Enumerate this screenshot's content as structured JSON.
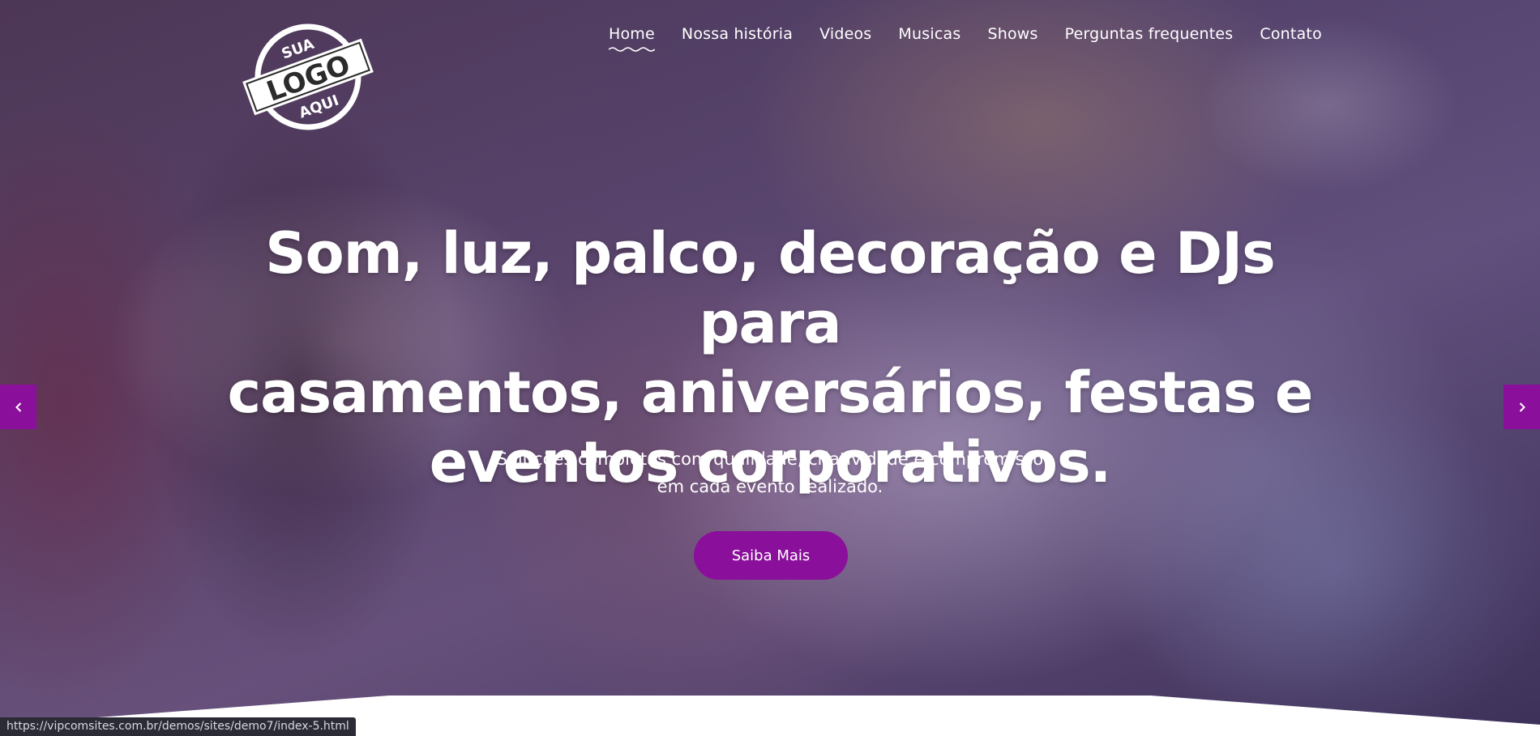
{
  "logo": {
    "top_text": "SUA",
    "main_text": "LOGO",
    "bottom_text": "AQUI"
  },
  "nav": {
    "items": [
      {
        "label": "Home",
        "active": true
      },
      {
        "label": "Nossa história",
        "active": false
      },
      {
        "label": "Videos",
        "active": false
      },
      {
        "label": "Musicas",
        "active": false
      },
      {
        "label": "Shows",
        "active": false
      },
      {
        "label": "Perguntas frequentes",
        "active": false
      },
      {
        "label": "Contato",
        "active": false
      }
    ]
  },
  "hero": {
    "headline_line1": "Som, luz, palco, decoração e DJs para",
    "headline_line2": "casamentos, aniversários, festas e",
    "headline_line3": "eventos corporativos.",
    "subtitle_line1": "Soluções completas com qualidade, criatividade e compromisso",
    "subtitle_line2": "em cada evento realizado.",
    "cta_label": "Saiba Mais"
  },
  "carousel": {
    "prev_icon": "chevron-left-icon",
    "next_icon": "chevron-right-icon"
  },
  "status_bar": {
    "url": "https://vipcomsites.com.br/demos/sites/demo7/index-5.html"
  },
  "colors": {
    "accent": "#8a0f9a",
    "text": "#ffffff"
  }
}
